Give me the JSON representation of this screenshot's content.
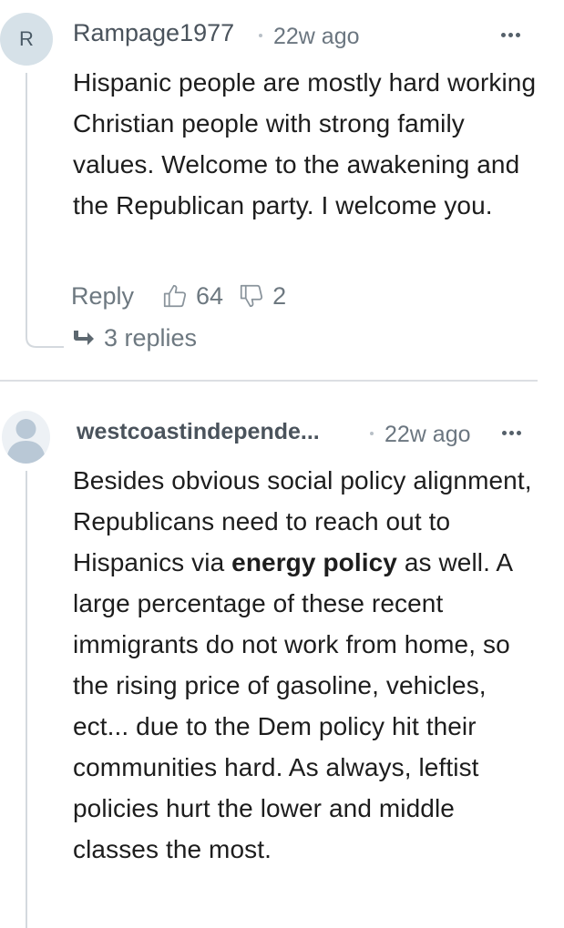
{
  "comments": [
    {
      "avatar_letter": "R",
      "username": "Rampage1977",
      "timestamp": "22w ago",
      "body": "Hispanic people are mostly hard working Christian people with strong family values. Welcome to the awakening and the Republican party. I welcome you.",
      "reply_label": "Reply",
      "upvotes": "64",
      "downvotes": "2",
      "replies_label": "3 replies"
    },
    {
      "avatar_icon": "user-silhouette-icon",
      "username": "westcoastindepende...",
      "timestamp": "22w ago",
      "body_part1": "Besides obvious social policy alignment, Republicans need to reach out to Hispanics via ",
      "body_bold": "energy policy",
      "body_part2": " as well. A large percentage of these recent immigrants do not work from home, so the rising price of gasoline, vehicles, ect... due to the Dem policy hit their communities hard. As always, leftist policies hurt the lower and middle classes the most."
    }
  ],
  "colors": {
    "avatar_bg": "#d6e1e8",
    "thread_line": "#d4d9de",
    "meta_text": "#6d7880"
  }
}
